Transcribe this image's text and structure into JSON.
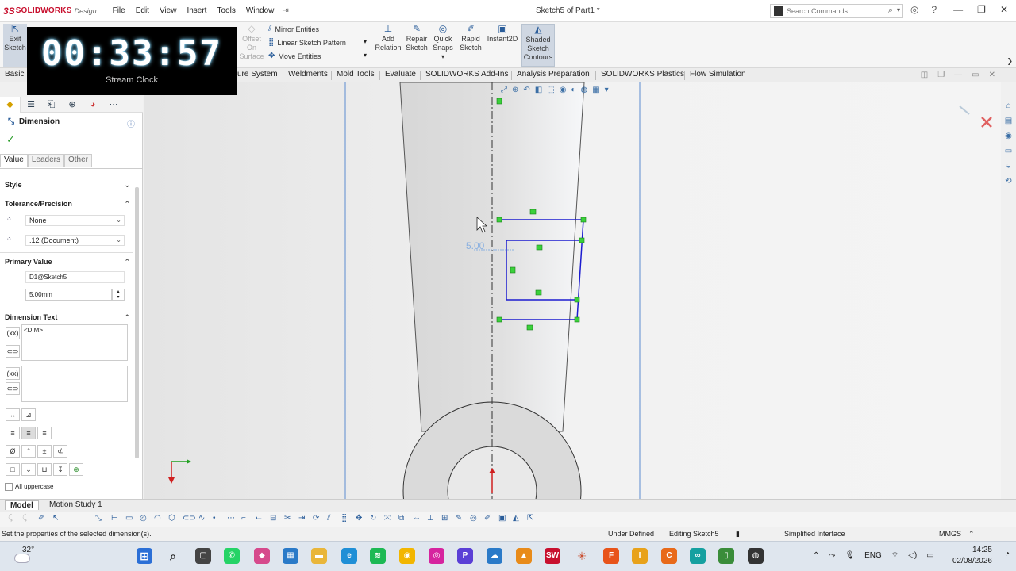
{
  "app": {
    "brand_ds": "3S",
    "brand_name": "SOLIDWORKS",
    "brand_suffix": "Design",
    "doc_title": "Sketch5 of Part1 *",
    "menu": [
      "File",
      "Edit",
      "View",
      "Insert",
      "Tools",
      "Window"
    ],
    "search_placeholder": "Search Commands"
  },
  "commands": {
    "exit_sketch_1": "Exit",
    "exit_sketch_2": "Sketch",
    "offset_1": "Offset",
    "offset_2": "On",
    "offset_3": "Surface",
    "mirror": "Mirror Entities",
    "linear_pattern": "Linear Sketch Pattern",
    "move": "Move Entities",
    "add_relation_1": "Add",
    "add_relation_2": "Relation",
    "repair_1": "Repair",
    "repair_2": "Sketch",
    "quick_snaps_1": "Quick",
    "quick_snaps_2": "Snaps",
    "rapid_1": "Rapid",
    "rapid_2": "Sketch",
    "instant2d": "Instant2D",
    "shaded_1": "Shaded",
    "shaded_2": "Sketch",
    "shaded_3": "Contours"
  },
  "clock": {
    "time": "00:33:57",
    "label": "Stream Clock"
  },
  "tabs": [
    "Basic",
    "ure System",
    "Weldments",
    "Mold Tools",
    "Evaluate",
    "SOLIDWORKS Add-Ins",
    "Analysis Preparation",
    "SOLIDWORKS Plastics",
    "Flow Simulation"
  ],
  "property_manager": {
    "title": "Dimension",
    "subtabs": [
      "Value",
      "Leaders",
      "Other"
    ],
    "style_label": "Style",
    "tolerance_label": "Tolerance/Precision",
    "tolerance_value": "None",
    "precision_value": ".12 (Document)",
    "primary_label": "Primary Value",
    "primary_name": "D1@Sketch5",
    "primary_value": "5.00mm",
    "dimtext_label": "Dimension Text",
    "dimtext_value": "<DIM>",
    "all_uppercase": "All uppercase"
  },
  "graphics": {
    "dim_label": "5.00"
  },
  "bottom_tabs": [
    "Model",
    "Motion Study 1"
  ],
  "status": {
    "hint": "Set the properties of the selected dimension(s).",
    "state": "Under Defined",
    "editing": "Editing Sketch5",
    "interface": "Simplified Interface",
    "units": "MMGS"
  },
  "taskbar": {
    "temperature": "32°",
    "language": "ENG",
    "time": "14:25",
    "date": "02/08/2026"
  }
}
